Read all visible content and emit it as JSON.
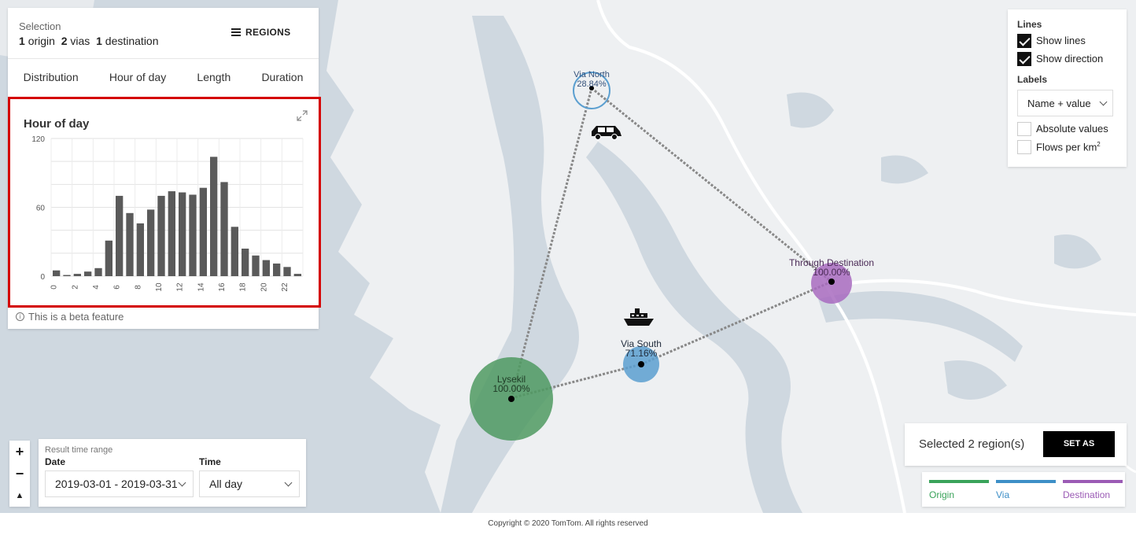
{
  "selection": {
    "title": "Selection",
    "origins_count": "1",
    "origins_label": "origin",
    "vias_count": "2",
    "vias_label": "vias",
    "destinations_count": "1",
    "destinations_label": "destination",
    "regions_button": "REGIONS"
  },
  "tabs": [
    {
      "label": "Distribution"
    },
    {
      "label": "Hour of day"
    },
    {
      "label": "Length"
    },
    {
      "label": "Duration"
    }
  ],
  "chart_data": {
    "type": "bar",
    "title": "Hour of day",
    "categories": [
      "0",
      "1",
      "2",
      "3",
      "4",
      "5",
      "6",
      "7",
      "8",
      "9",
      "10",
      "11",
      "12",
      "13",
      "14",
      "15",
      "16",
      "17",
      "18",
      "19",
      "20",
      "21",
      "22",
      "23"
    ],
    "values": [
      5,
      1,
      2,
      4,
      7,
      31,
      70,
      55,
      46,
      58,
      70,
      74,
      73,
      71,
      77,
      104,
      82,
      43,
      24,
      18,
      14,
      11,
      8,
      2
    ],
    "ylim": [
      0,
      120
    ],
    "yticks": [
      "0",
      "60",
      "120"
    ],
    "xticks": [
      "0",
      "2",
      "4",
      "6",
      "8",
      "10",
      "12",
      "14",
      "16",
      "18",
      "20",
      "22"
    ],
    "bar_color": "#5a5a5a"
  },
  "beta_note": "This is a beta feature",
  "display_options": {
    "lines_heading": "Lines",
    "show_lines": {
      "label": "Show lines",
      "checked": true
    },
    "show_direction": {
      "label": "Show direction",
      "checked": true
    },
    "labels_heading": "Labels",
    "labels_value": "Name + value",
    "absolute_values": {
      "label": "Absolute values",
      "checked": false
    },
    "flows_per_km": {
      "label": "Flows per km",
      "sup": "2",
      "checked": false
    }
  },
  "time_range": {
    "title": "Result time range",
    "date_label": "Date",
    "date_value": "2019-03-01 - 2019-03-31",
    "time_label": "Time",
    "time_value": "All day"
  },
  "selected": {
    "text": "Selected 2 region(s)",
    "button": "SET AS"
  },
  "legend": [
    {
      "label": "Origin",
      "color": "#3aa35a"
    },
    {
      "label": "Via",
      "color": "#3d8fc7"
    },
    {
      "label": "Destination",
      "color": "#9b5bb5"
    }
  ],
  "map_regions": {
    "via_north": {
      "name": "Via North",
      "value": "28.84%"
    },
    "via_south": {
      "name": "Via South",
      "value": "71.16%"
    },
    "origin": {
      "name": "Lysekil",
      "value": "100.00%"
    },
    "destination": {
      "name": "Through Destination",
      "value": "100.00%"
    }
  },
  "copyright": "Copyright © 2020 TomTom. All rights reserved",
  "colors": {
    "origin_fill": "#4f9a62",
    "via_fill": "#5b9fd0",
    "destination_fill": "#a86bbf",
    "water": "#cfd8e0",
    "land": "#eef0f2"
  }
}
